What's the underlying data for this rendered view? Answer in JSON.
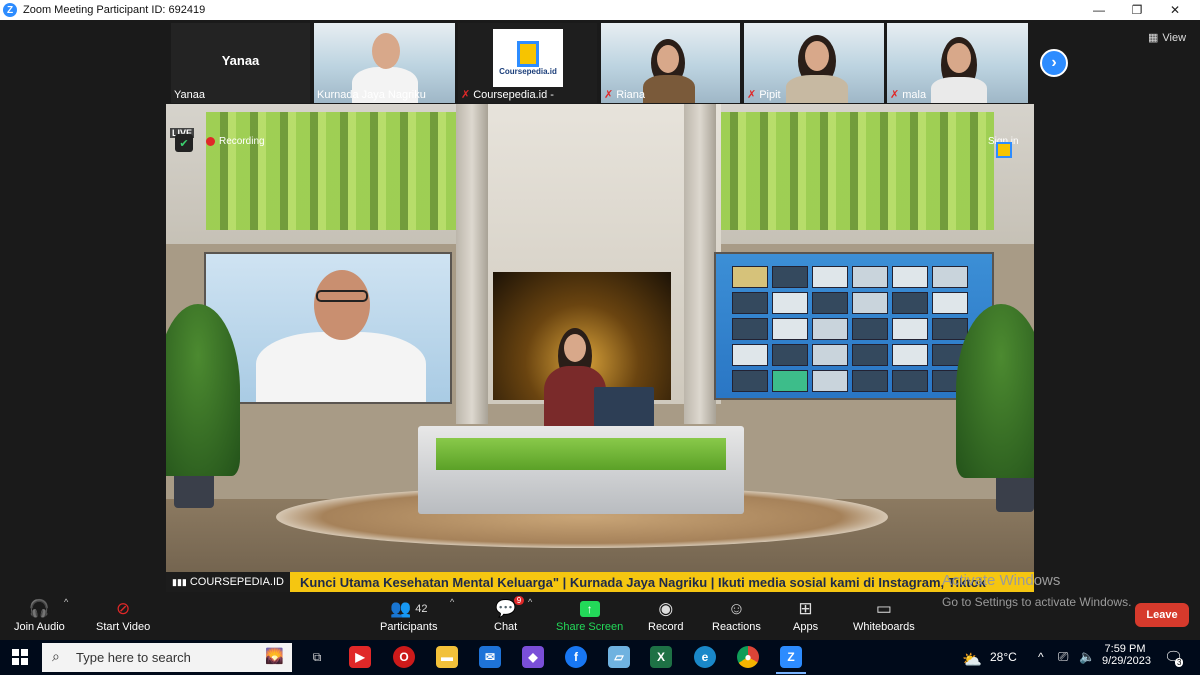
{
  "window": {
    "title": "Zoom Meeting Participant ID: 692419",
    "logo_letter": "Z"
  },
  "window_controls": {
    "minimize": "—",
    "restore": "❐",
    "close": "✕"
  },
  "thumbnails": [
    {
      "name": "Yanaa",
      "big_name": "Yanaa",
      "muted": false
    },
    {
      "name": "Kurnada Jaya Nagriku",
      "muted": false
    },
    {
      "name": "Coursepedia.id -",
      "muted": true,
      "logo_text": "Coursepedia.id"
    },
    {
      "name": "Riana",
      "muted": true
    },
    {
      "name": "Pipit",
      "muted": true
    },
    {
      "name": "mala",
      "muted": true
    }
  ],
  "view_label": "View",
  "stage": {
    "live_tag": "LIVE",
    "recording_label": "Recording",
    "sign_in_label": "Sign in",
    "ticker_tag": "COURSEPEDIA.ID",
    "ticker_text": "Kunci Utama Kesehatan Mental Keluarga\" | Kurnada Jaya Nagriku | Ikuti media sosial kami di Instagram, Tiktok"
  },
  "activate_windows": {
    "line1": "Activate Windows",
    "line2": "Go to Settings to activate Windows."
  },
  "toolbar": {
    "join_audio": "Join Audio",
    "start_video": "Start Video",
    "participants": "Participants",
    "participants_count": "42",
    "chat": "Chat",
    "chat_badge": "9",
    "share_screen": "Share Screen",
    "record": "Record",
    "reactions": "Reactions",
    "apps": "Apps",
    "whiteboards": "Whiteboards",
    "leave": "Leave"
  },
  "taskbar": {
    "search_placeholder": "Type here to search",
    "temperature": "28°C",
    "time": "7:59 PM",
    "date": "9/29/2023",
    "notification_count": "3"
  },
  "colors": {
    "zoom_blue": "#2d8cff",
    "leave_red": "#d63a2c",
    "share_green": "#23d959",
    "ticker_yellow": "#f5c611"
  }
}
